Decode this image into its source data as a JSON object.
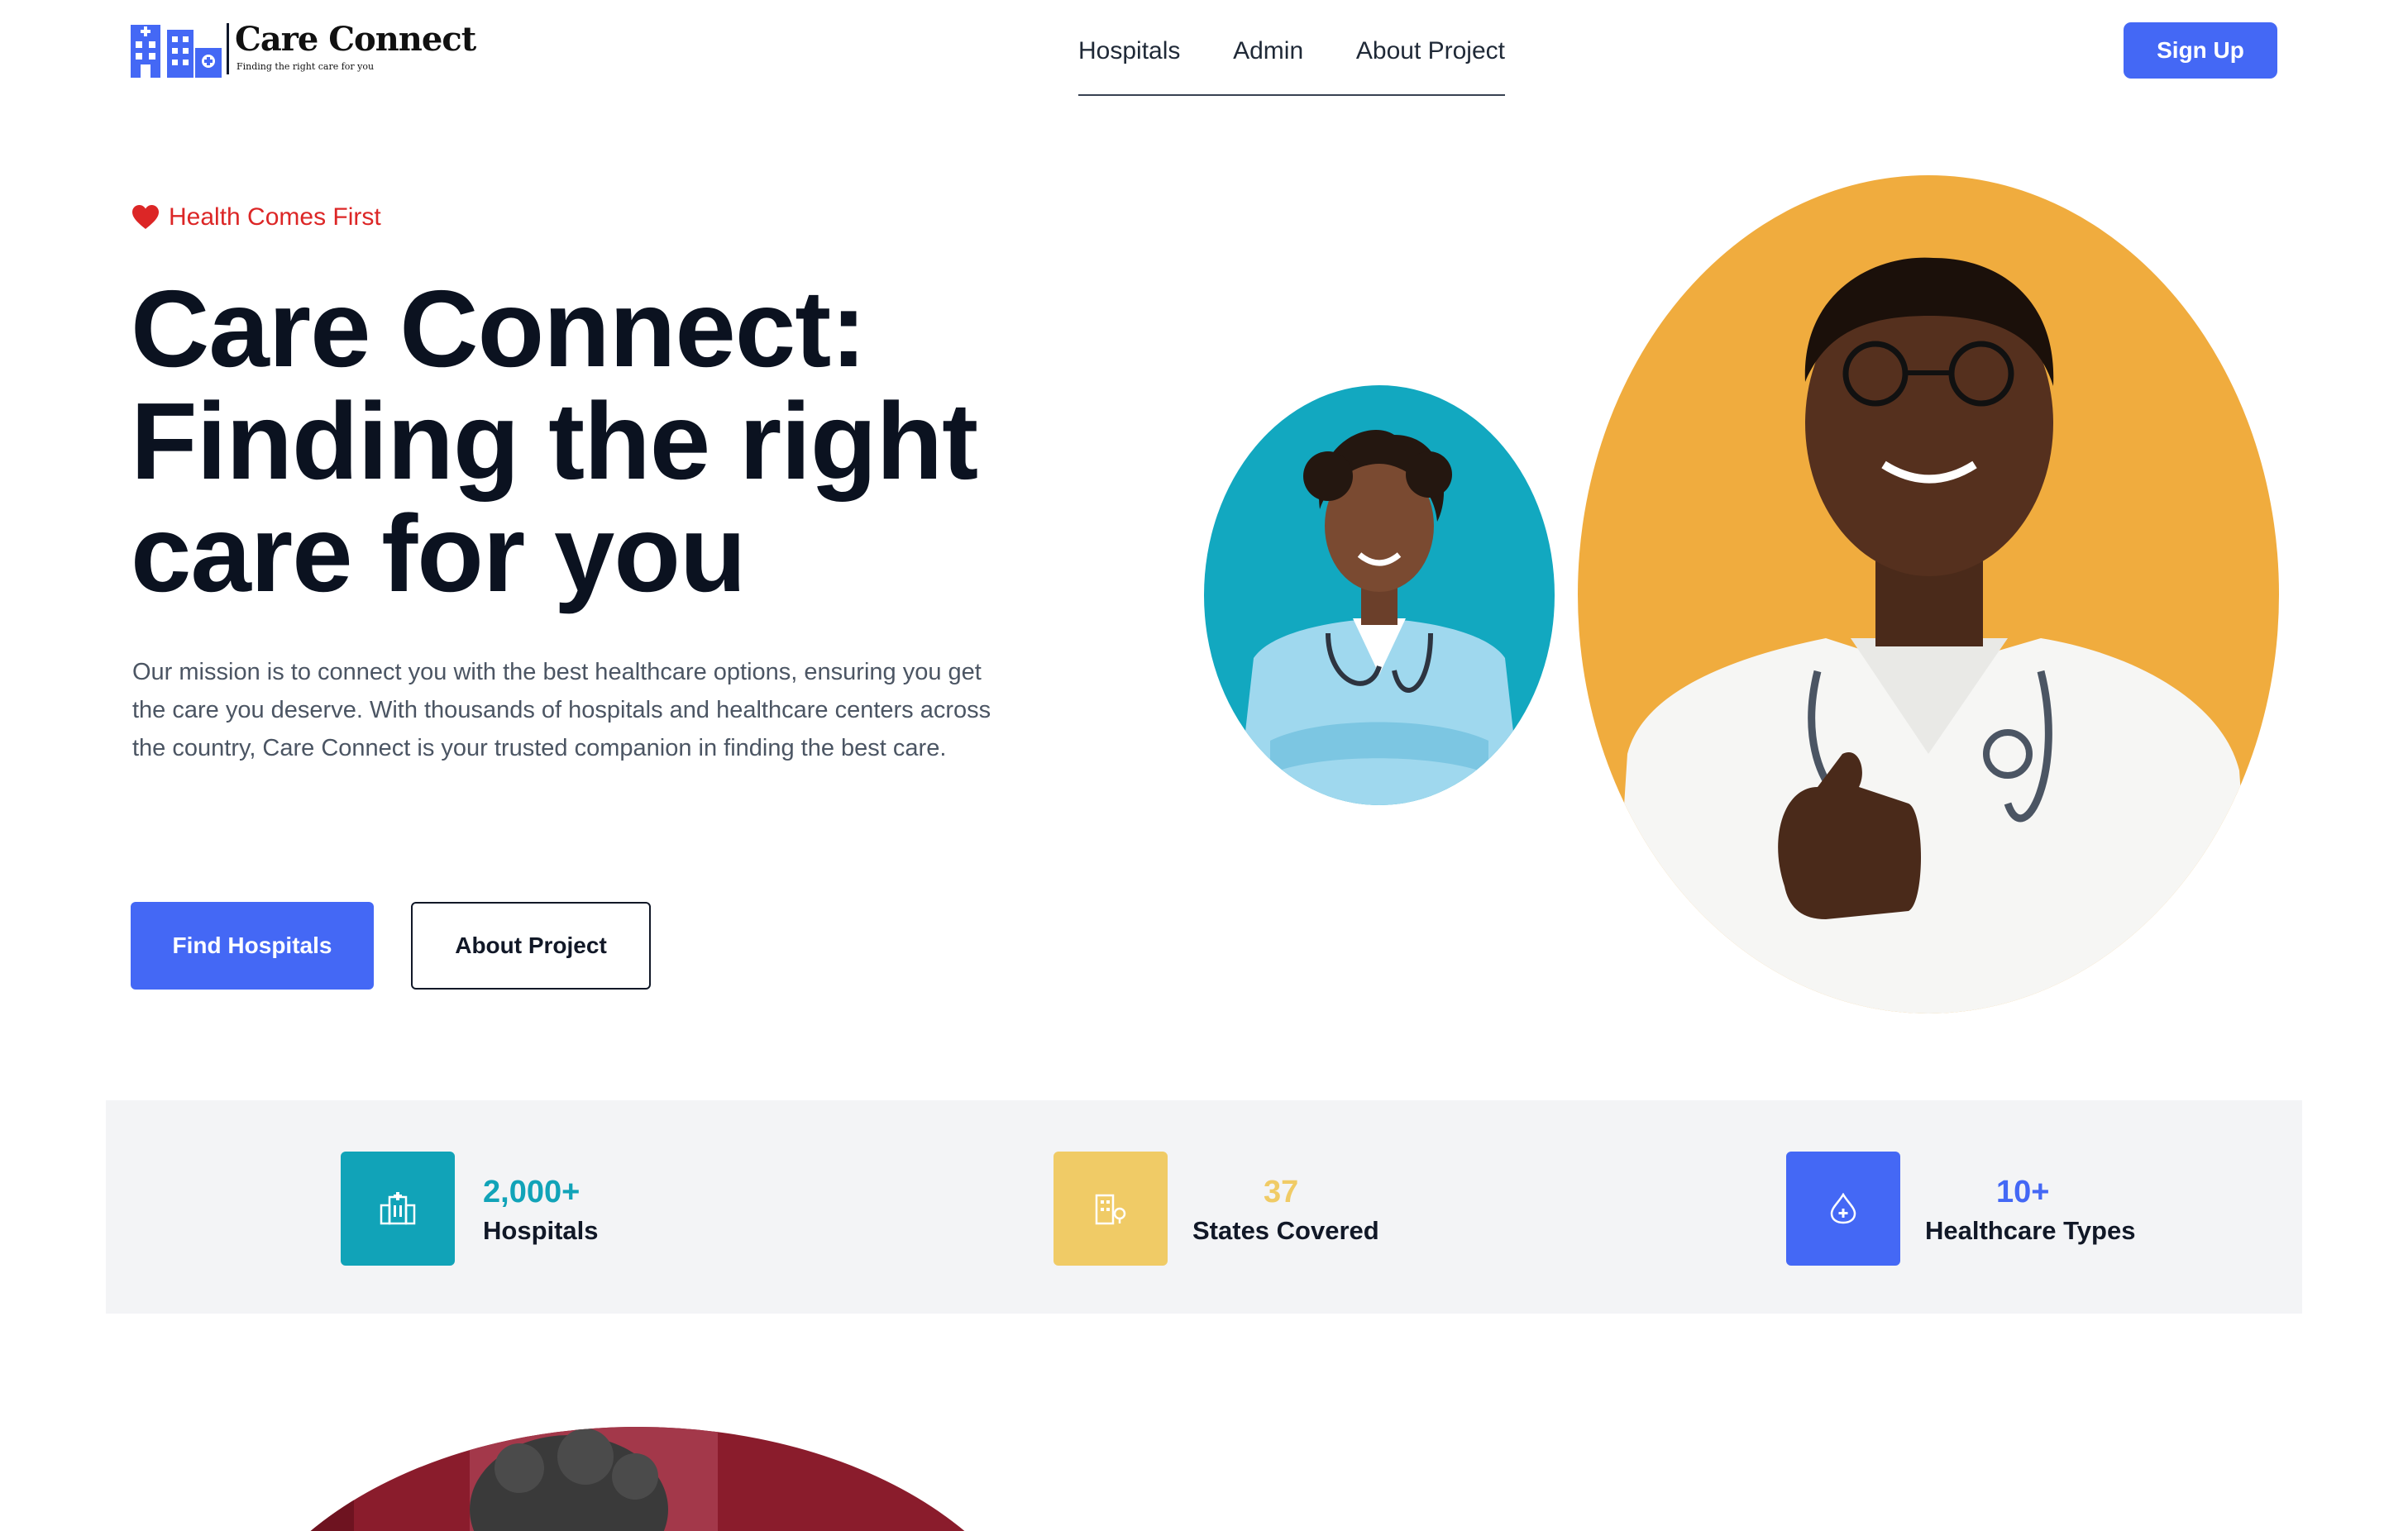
{
  "brand": {
    "name": "Care Connect",
    "tagline": "Finding the right care for you"
  },
  "nav": {
    "items": [
      "Hospitals",
      "Admin",
      "About Project"
    ],
    "signup_label": "Sign Up"
  },
  "hero": {
    "eyebrow": "Health Comes First",
    "title_lines": [
      "Care Connect:",
      "Finding the right",
      "care for you"
    ],
    "description": "Our mission is to connect you with the best healthcare options, ensuring you get the care you deserve. With thousands of hospitals and healthcare centers across the country, Care Connect is your trusted companion in finding the best care.",
    "primary_cta": "Find Hospitals",
    "secondary_cta": "About Project"
  },
  "stats": [
    {
      "value": "2,000+",
      "label": "Hospitals",
      "icon": "hospital-building-icon",
      "color": "#11a3b8"
    },
    {
      "value": "37",
      "label": "States Covered",
      "icon": "building-location-icon",
      "color": "#f0cb66"
    },
    {
      "value": "10+",
      "label": "Healthcare Types",
      "icon": "blood-drop-icon",
      "color": "#4468f5"
    }
  ],
  "colors": {
    "accent": "#4468f5",
    "eyebrow": "#dc2626",
    "teal": "#11a3b8",
    "gold": "#f0cb66",
    "photo_small_bg": "#12a8c0",
    "photo_large_bg": "#f0ac3e"
  }
}
